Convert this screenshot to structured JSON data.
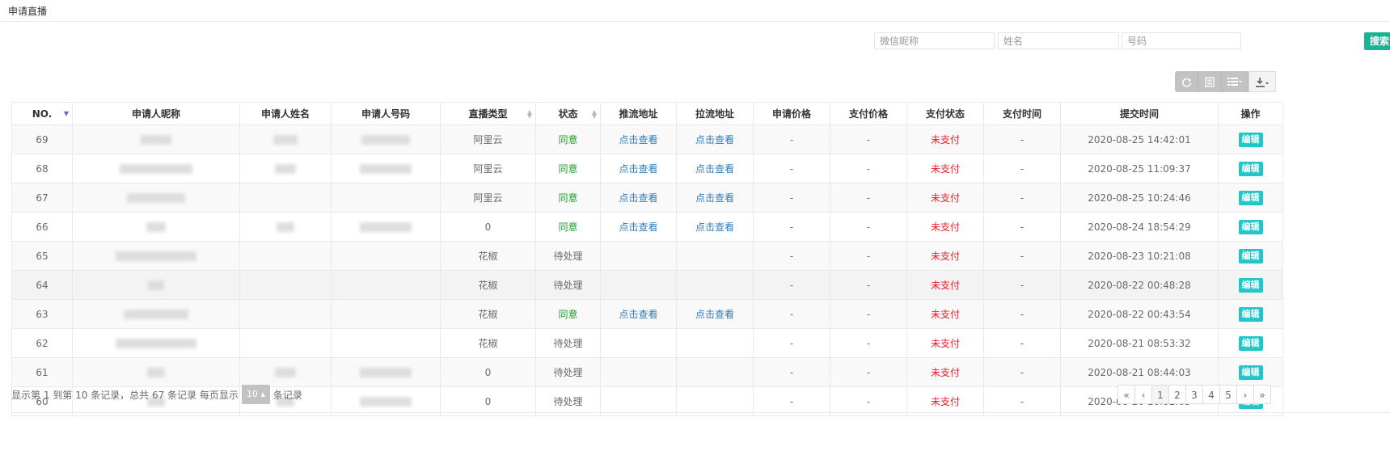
{
  "page_title": "申请直播",
  "search": {
    "nickname_placeholder": "微信昵称",
    "name_placeholder": "姓名",
    "phone_placeholder": "号码",
    "button_label": "搜索"
  },
  "icons": {
    "refresh": "refresh-icon",
    "toggle_view": "list-icon",
    "columns": "columns-icon",
    "export": "export-icon"
  },
  "colors": {
    "accent": "#1ab394",
    "edit": "#23c6c8",
    "agree": "#1f9e2c",
    "unpaid": "#ed1c24",
    "link": "#337ab7"
  },
  "table": {
    "columns": [
      "NO.",
      "申请人昵称",
      "申请人姓名",
      "申请人号码",
      "直播类型",
      "状态",
      "推流地址",
      "拉流地址",
      "申请价格",
      "支付价格",
      "支付状态",
      "支付时间",
      "提交时间",
      "操作"
    ],
    "rows": [
      {
        "no": "69",
        "type": "阿里云",
        "status": "同意",
        "push": "点击查看",
        "pull": "点击查看",
        "apply_price": "-",
        "pay_price": "-",
        "pay_status": "未支付",
        "pay_time": "-",
        "submit_time": "2020-08-25 14:42:01",
        "action": "编辑"
      },
      {
        "no": "68",
        "type": "阿里云",
        "status": "同意",
        "push": "点击查看",
        "pull": "点击查看",
        "apply_price": "-",
        "pay_price": "-",
        "pay_status": "未支付",
        "pay_time": "-",
        "submit_time": "2020-08-25 11:09:37",
        "action": "编辑"
      },
      {
        "no": "67",
        "type": "阿里云",
        "status": "同意",
        "push": "点击查看",
        "pull": "点击查看",
        "apply_price": "-",
        "pay_price": "-",
        "pay_status": "未支付",
        "pay_time": "-",
        "submit_time": "2020-08-25 10:24:46",
        "action": "编辑"
      },
      {
        "no": "66",
        "type": "0",
        "status": "同意",
        "push": "点击查看",
        "pull": "点击查看",
        "apply_price": "-",
        "pay_price": "-",
        "pay_status": "未支付",
        "pay_time": "-",
        "submit_time": "2020-08-24 18:54:29",
        "action": "编辑"
      },
      {
        "no": "65",
        "type": "花椒",
        "status": "待处理",
        "push": "",
        "pull": "",
        "apply_price": "-",
        "pay_price": "-",
        "pay_status": "未支付",
        "pay_time": "-",
        "submit_time": "2020-08-23 10:21:08",
        "action": "编辑"
      },
      {
        "no": "64",
        "type": "花椒",
        "status": "待处理",
        "push": "",
        "pull": "",
        "apply_price": "-",
        "pay_price": "-",
        "pay_status": "未支付",
        "pay_time": "-",
        "submit_time": "2020-08-22 00:48:28",
        "action": "编辑"
      },
      {
        "no": "63",
        "type": "花椒",
        "status": "同意",
        "push": "点击查看",
        "pull": "点击查看",
        "apply_price": "-",
        "pay_price": "-",
        "pay_status": "未支付",
        "pay_time": "-",
        "submit_time": "2020-08-22 00:43:54",
        "action": "编辑"
      },
      {
        "no": "62",
        "type": "花椒",
        "status": "待处理",
        "push": "",
        "pull": "",
        "apply_price": "-",
        "pay_price": "-",
        "pay_status": "未支付",
        "pay_time": "-",
        "submit_time": "2020-08-21 08:53:32",
        "action": "编辑"
      },
      {
        "no": "61",
        "type": "0",
        "status": "待处理",
        "push": "",
        "pull": "",
        "apply_price": "-",
        "pay_price": "-",
        "pay_status": "未支付",
        "pay_time": "-",
        "submit_time": "2020-08-21 08:44:03",
        "action": "编辑"
      },
      {
        "no": "60",
        "type": "0",
        "status": "待处理",
        "push": "",
        "pull": "",
        "apply_price": "-",
        "pay_price": "-",
        "pay_status": "未支付",
        "pay_time": "-",
        "submit_time": "2020-08-20 10:02:03",
        "action": "编辑"
      }
    ]
  },
  "footer": {
    "info_prefix": "显示第 1 到第 10 条记录，总共 67 条记录 每页显示",
    "page_size": "10",
    "info_suffix": "条记录"
  },
  "pagination": {
    "first": "«",
    "prev": "‹",
    "pages": [
      "1",
      "2",
      "3",
      "4",
      "5"
    ],
    "current": "1",
    "next": "›",
    "last": "»"
  }
}
